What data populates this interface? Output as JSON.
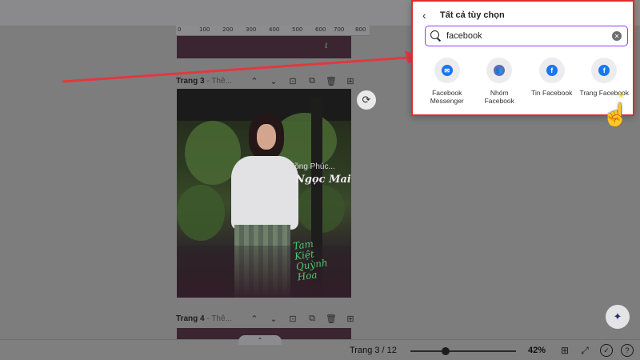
{
  "ruler": {
    "ticks": [
      "0",
      "100",
      "200",
      "300",
      "400",
      "500",
      "600",
      "700",
      "800"
    ]
  },
  "page3": {
    "label": "Trang 3",
    "sub": " - Thê...",
    "tools": [
      "chevron-up-icon",
      "chevron-down-icon",
      "lock-icon",
      "duplicate-icon",
      "trash-icon",
      "add-page-icon"
    ],
    "text_line1": "Hồng Phúc...",
    "text_line2": "Ngọc Mai",
    "text_line3": "Tam\nKiệt\nQuỳnh\nHoa"
  },
  "page4": {
    "label": "Trang 4",
    "sub": " - Thê..."
  },
  "rotate_glyph": "⟳",
  "magic_glyph": "✦",
  "bottom": {
    "collapse_glyph": "⌃",
    "pager": "Trang 3 / 12",
    "zoom": "42%",
    "zoom_fraction": 0.33
  },
  "popup": {
    "title": "Tất cả tùy chọn",
    "search_value": "facebook",
    "options": [
      {
        "label": "Facebook\nMessenger",
        "glyph": "✉",
        "icon": "messenger-icon"
      },
      {
        "label": "Nhóm\nFacebook",
        "glyph": "👥",
        "icon": "group-icon"
      },
      {
        "label": "Tin Facebook",
        "glyph": "f",
        "icon": "facebook-story-icon"
      },
      {
        "label": "Trang Facebook",
        "glyph": "f",
        "icon": "facebook-page-icon"
      }
    ]
  },
  "colors": {
    "highlight": "#e02b2b",
    "search_border": "#8b3dff",
    "facebook_blue": "#1877f2",
    "arrow": "#e2383f"
  }
}
